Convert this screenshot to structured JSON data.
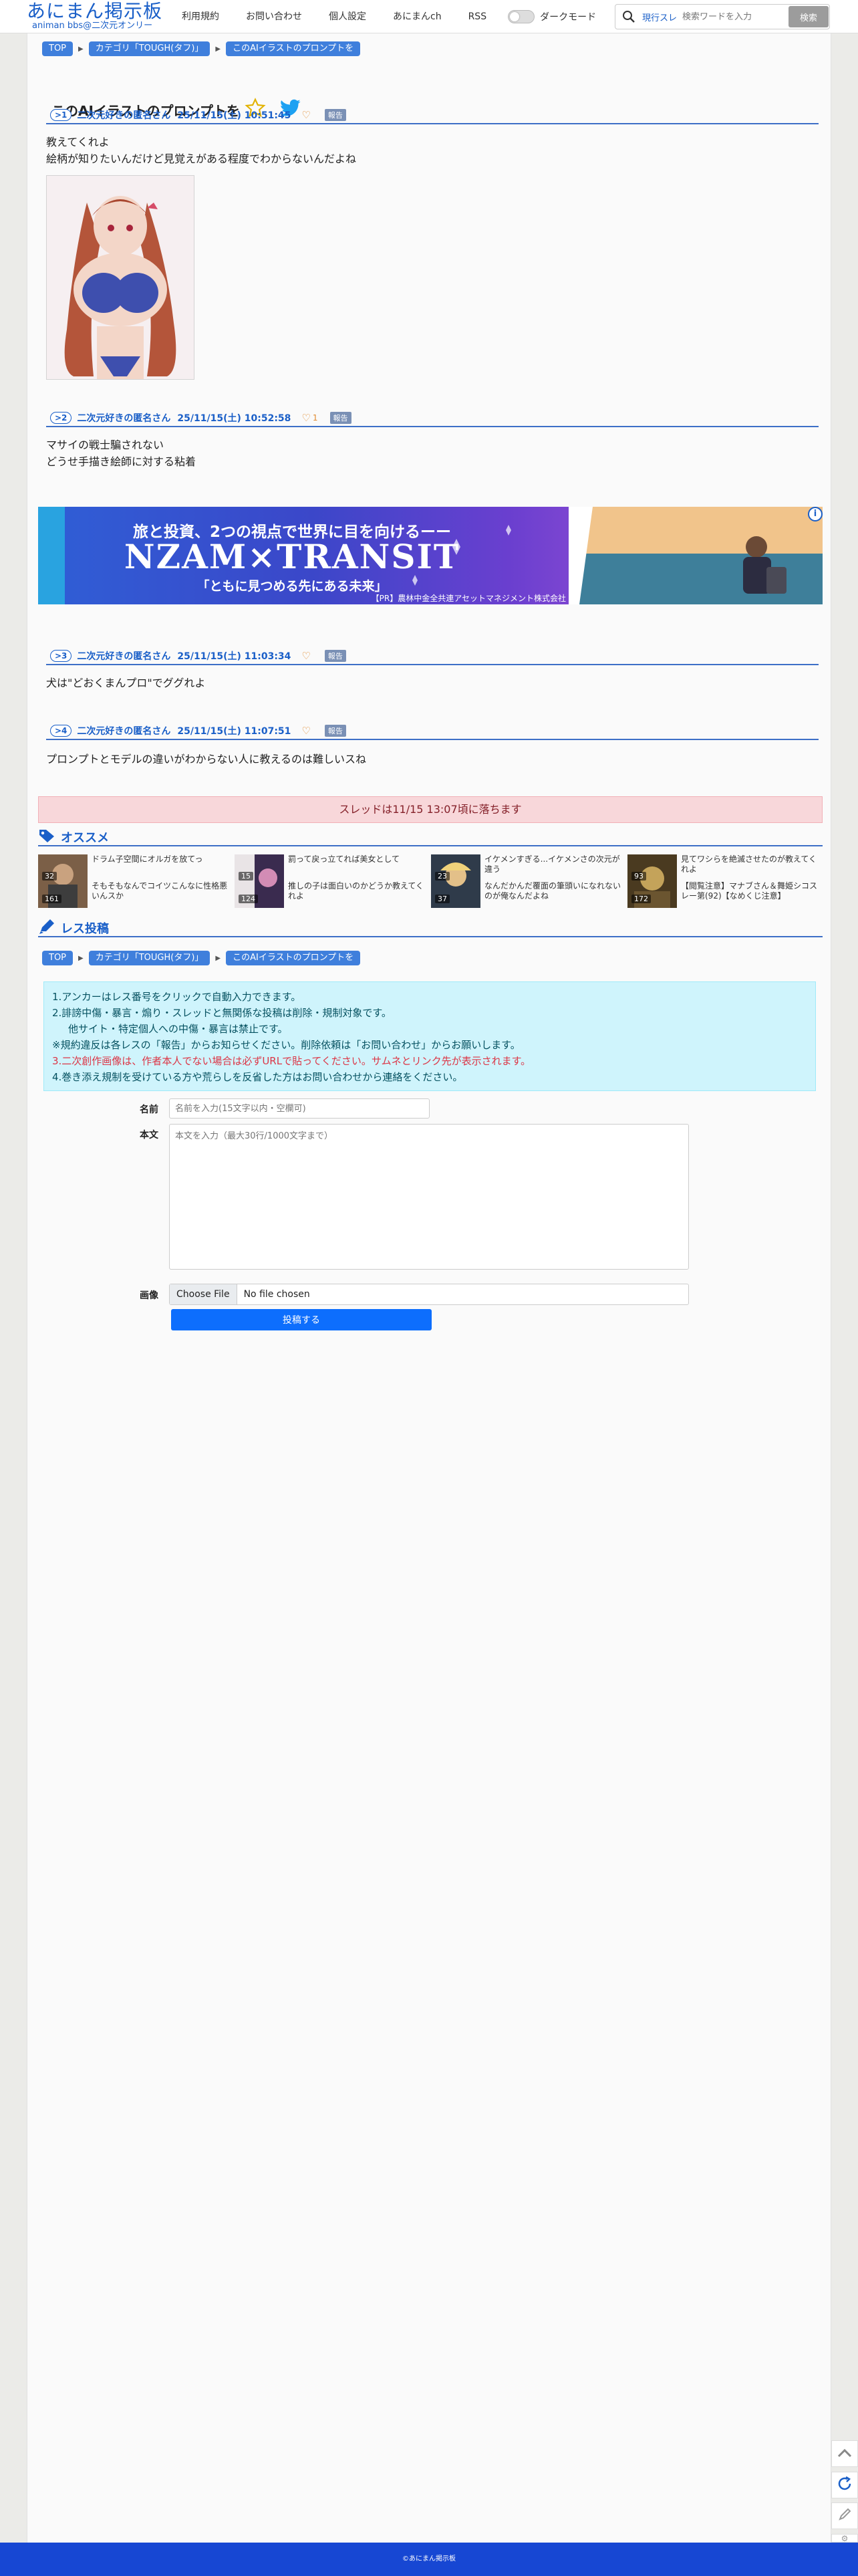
{
  "header": {
    "logo_main": "あにまん掲示板",
    "logo_sub": "animan bbs@二次元オンリー",
    "nav": [
      {
        "label": "利用規約"
      },
      {
        "label": "お問い合わせ"
      },
      {
        "label": "個人設定"
      },
      {
        "label": "あにまんch"
      },
      {
        "label": "RSS"
      }
    ],
    "dark_mode_label": "ダークモード",
    "search_scope": "現行スレ",
    "search_placeholder": "検索ワードを入力",
    "search_button": "検索"
  },
  "breadcrumb": [
    "TOP",
    "カテゴリ「TOUGH(タフ)」",
    "このAIイラストのプロンプトを"
  ],
  "thread": {
    "title": "このAIイラストのプロンプトを"
  },
  "posts": [
    {
      "num": ">1",
      "name": "二次元好きの匿名さん",
      "date": "25/11/15(土) 10:51:45",
      "likes": "",
      "report": "報告",
      "body": "教えてくれよ\n絵柄が知りたいんだけど見覚えがある程度でわからないんだよね"
    },
    {
      "num": ">2",
      "name": "二次元好きの匿名さん",
      "date": "25/11/15(土) 10:52:58",
      "likes": "1",
      "report": "報告",
      "body": "マサイの戦士騙されない\nどうせ手描き絵師に対する粘着"
    },
    {
      "num": ">3",
      "name": "二次元好きの匿名さん",
      "date": "25/11/15(土) 11:03:34",
      "likes": "",
      "report": "報告",
      "body": "犬は\"どおくまんプロ\"でググれよ"
    },
    {
      "num": ">4",
      "name": "二次元好きの匿名さん",
      "date": "25/11/15(土) 11:07:51",
      "likes": "",
      "report": "報告",
      "body": "プロンプトとモデルの違いがわからない人に教えるのは難しいスね"
    }
  ],
  "ad": {
    "headline": "旅と投資、2つの視点で世界に目を向けるーー",
    "brand": "NZAM×TRANSIT",
    "tagline": "「ともに見つめる先にある未来」",
    "sponsor": "【PR】農林中金全共連アセットマネジメント株式会社",
    "info_icon": "i"
  },
  "expire_notice": "スレッドは11/15 13:07頃に落ちます",
  "recommend": {
    "heading": "オススメ",
    "items": [
      {
        "count": "32",
        "count2": "161",
        "text": "ドラム子空間にオルガを放てっ",
        "text2": "そもそもなんでコイツこんなに性格悪いんスか"
      },
      {
        "count": "15",
        "count2": "124",
        "text": "罰って戻っ立てれば美女として",
        "text2": "推しの子は面白いのかどうか教えてくれよ"
      },
      {
        "count": "23",
        "count2": "37",
        "text": "イケメンすぎる...イケメンさの次元が違う",
        "text2": "なんだかんだ覆面の筆頭いになれないのが俺なんだよね"
      },
      {
        "count": "93",
        "count2": "172",
        "text": "見てワシらを絶滅させたのが教えてくれよ",
        "text2": "【閲覧注意】マナブさん＆舞姫シコスレー第(92)【なめくじ注意】"
      }
    ]
  },
  "post_form": {
    "heading": "レス投稿",
    "rules": [
      "1.アンカーはレス番号をクリックで自動入力できます。",
      "2.誹謗中傷・暴言・煽り・スレッドと無関係な投稿は削除・規制対象です。",
      "他サイト・特定個人への中傷・暴言は禁止です。",
      "※規約違反は各レスの「報告」からお知らせください。削除依頼は「お問い合わせ」からお願いします。",
      "3.二次創作画像は、作者本人でない場合は必ずURLで貼ってください。サムネとリンク先が表示されます。",
      "4.巻き添え規制を受けている方や荒らしを反省した方はお問い合わせから連絡をください。"
    ],
    "name_label": "名前",
    "name_placeholder": "名前を入力(15文字以内・空欄可)",
    "body_label": "本文",
    "body_placeholder": "本文を入力（最大30行/1000文字まで）",
    "image_label": "画像",
    "file_button": "Choose File",
    "file_status": "No file chosen",
    "submit": "投稿する"
  },
  "footer": {
    "copyright": "©あにまん掲示板"
  },
  "colors": {
    "accent": "#1a5fc8",
    "breadcrumb": "#3f7fdc",
    "submit": "#0d6efd",
    "footer": "#1747d3"
  }
}
